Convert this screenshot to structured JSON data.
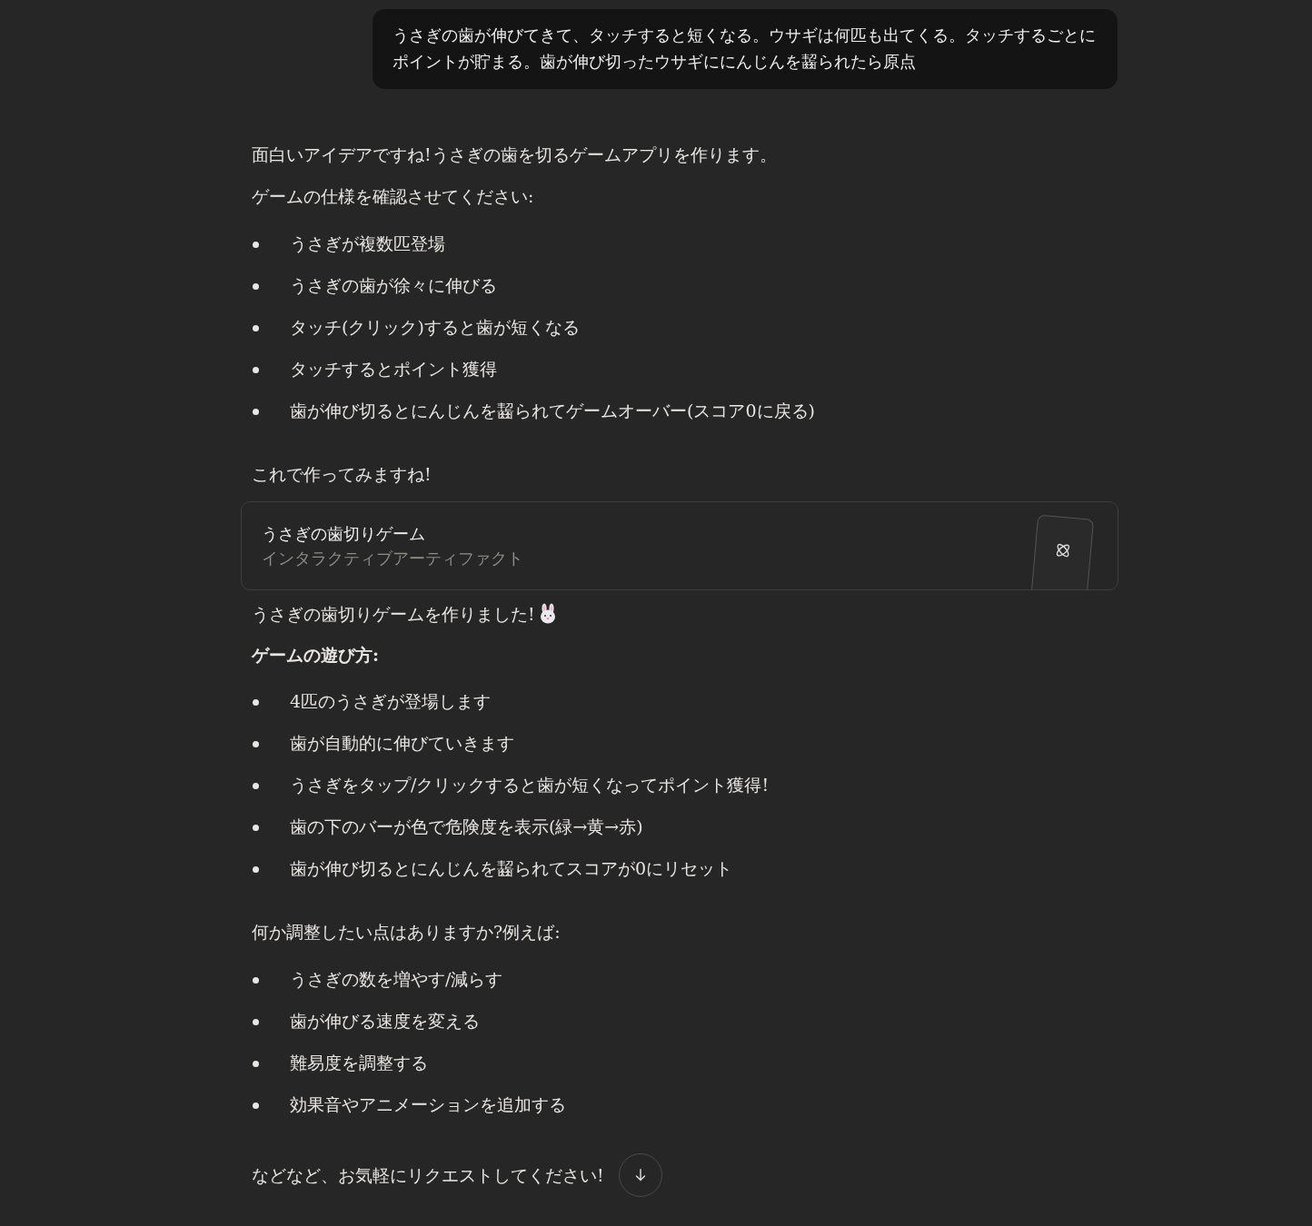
{
  "user_message": "うさぎの歯が伸びてきて、タッチすると短くなる。ウサギは何匹も出てくる。タッチするごとにポイントが貯まる。歯が伸び切ったウサギににんじんを齧られたら原点",
  "response": [
    {
      "kind": "paragraph",
      "text": "面白いアイデアですね!うさぎの歯を切るゲームアプリを作ります。"
    },
    {
      "kind": "paragraph",
      "text": "ゲームの仕様を確認させてください:"
    },
    {
      "kind": "bullets",
      "items": [
        "うさぎが複数匹登場",
        "うさぎの歯が徐々に伸びる",
        "タッチ(クリック)すると歯が短くなる",
        "タッチするとポイント獲得",
        "歯が伸び切るとにんじんを齧られてゲームオーバー(スコア0に戻る)"
      ]
    },
    {
      "kind": "paragraph",
      "text": "これで作ってみますね!"
    },
    {
      "kind": "artifact",
      "title": "うさぎの歯切りゲーム",
      "subtitle": "インタラクティブアーティファクト"
    },
    {
      "kind": "paragraph",
      "text": "うさぎの歯切りゲームを作りました!",
      "rabbit": true
    },
    {
      "kind": "heading",
      "text": "ゲームの遊び方:"
    },
    {
      "kind": "bullets",
      "items": [
        "4匹のうさぎが登場します",
        "歯が自動的に伸びていきます",
        "うさぎをタップ/クリックすると歯が短くなってポイント獲得!",
        "歯の下のバーが色で危険度を表示(緑→黄→赤)",
        "歯が伸び切るとにんじんを齧られてスコアが0にリセット"
      ]
    },
    {
      "kind": "paragraph",
      "text": "何か調整したい点はありますか?例えば:"
    },
    {
      "kind": "bullets",
      "items": [
        "うさぎの数を増やす/減らす",
        "歯が伸びる速度を変える",
        "難易度を調整する",
        "効果音やアニメーションを追加する"
      ]
    },
    {
      "kind": "paragraph",
      "text": "などなど、お気軽にリクエストしてください!",
      "scroll_button": true
    }
  ]
}
